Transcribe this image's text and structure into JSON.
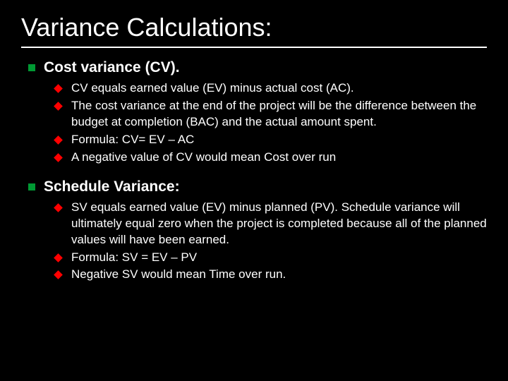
{
  "title": "Variance Calculations:",
  "sections": [
    {
      "heading": "Cost variance (CV).",
      "items": [
        " CV equals earned value (EV) minus actual cost (AC).",
        "The cost variance at the end of the project will be the difference between the budget at completion (BAC) and the actual amount spent.",
        "Formula: CV= EV – AC",
        "A negative value of CV would mean Cost over run"
      ]
    },
    {
      "heading": "Schedule Variance:",
      "items": [
        "SV equals earned value (EV) minus planned  (PV). Schedule variance will ultimately equal zero when the project is completed because all of the planned values will have been earned.",
        "Formula: SV = EV – PV",
        "Negative SV would mean Time over run."
      ]
    }
  ]
}
